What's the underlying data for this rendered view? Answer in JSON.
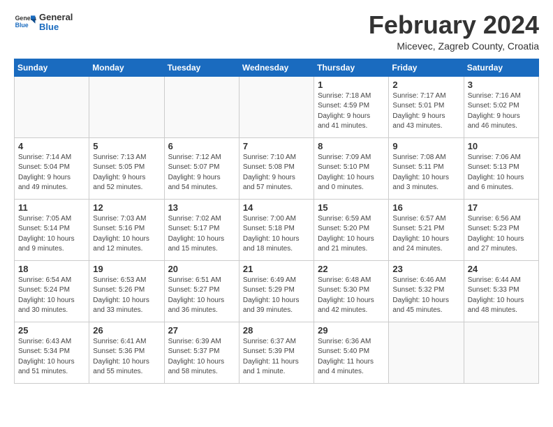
{
  "header": {
    "logo_line1": "General",
    "logo_line2": "Blue",
    "month_title": "February 2024",
    "location": "Micevec, Zagreb County, Croatia"
  },
  "weekdays": [
    "Sunday",
    "Monday",
    "Tuesday",
    "Wednesday",
    "Thursday",
    "Friday",
    "Saturday"
  ],
  "weeks": [
    [
      {
        "day": "",
        "info": ""
      },
      {
        "day": "",
        "info": ""
      },
      {
        "day": "",
        "info": ""
      },
      {
        "day": "",
        "info": ""
      },
      {
        "day": "1",
        "info": "Sunrise: 7:18 AM\nSunset: 4:59 PM\nDaylight: 9 hours\nand 41 minutes."
      },
      {
        "day": "2",
        "info": "Sunrise: 7:17 AM\nSunset: 5:01 PM\nDaylight: 9 hours\nand 43 minutes."
      },
      {
        "day": "3",
        "info": "Sunrise: 7:16 AM\nSunset: 5:02 PM\nDaylight: 9 hours\nand 46 minutes."
      }
    ],
    [
      {
        "day": "4",
        "info": "Sunrise: 7:14 AM\nSunset: 5:04 PM\nDaylight: 9 hours\nand 49 minutes."
      },
      {
        "day": "5",
        "info": "Sunrise: 7:13 AM\nSunset: 5:05 PM\nDaylight: 9 hours\nand 52 minutes."
      },
      {
        "day": "6",
        "info": "Sunrise: 7:12 AM\nSunset: 5:07 PM\nDaylight: 9 hours\nand 54 minutes."
      },
      {
        "day": "7",
        "info": "Sunrise: 7:10 AM\nSunset: 5:08 PM\nDaylight: 9 hours\nand 57 minutes."
      },
      {
        "day": "8",
        "info": "Sunrise: 7:09 AM\nSunset: 5:10 PM\nDaylight: 10 hours\nand 0 minutes."
      },
      {
        "day": "9",
        "info": "Sunrise: 7:08 AM\nSunset: 5:11 PM\nDaylight: 10 hours\nand 3 minutes."
      },
      {
        "day": "10",
        "info": "Sunrise: 7:06 AM\nSunset: 5:13 PM\nDaylight: 10 hours\nand 6 minutes."
      }
    ],
    [
      {
        "day": "11",
        "info": "Sunrise: 7:05 AM\nSunset: 5:14 PM\nDaylight: 10 hours\nand 9 minutes."
      },
      {
        "day": "12",
        "info": "Sunrise: 7:03 AM\nSunset: 5:16 PM\nDaylight: 10 hours\nand 12 minutes."
      },
      {
        "day": "13",
        "info": "Sunrise: 7:02 AM\nSunset: 5:17 PM\nDaylight: 10 hours\nand 15 minutes."
      },
      {
        "day": "14",
        "info": "Sunrise: 7:00 AM\nSunset: 5:18 PM\nDaylight: 10 hours\nand 18 minutes."
      },
      {
        "day": "15",
        "info": "Sunrise: 6:59 AM\nSunset: 5:20 PM\nDaylight: 10 hours\nand 21 minutes."
      },
      {
        "day": "16",
        "info": "Sunrise: 6:57 AM\nSunset: 5:21 PM\nDaylight: 10 hours\nand 24 minutes."
      },
      {
        "day": "17",
        "info": "Sunrise: 6:56 AM\nSunset: 5:23 PM\nDaylight: 10 hours\nand 27 minutes."
      }
    ],
    [
      {
        "day": "18",
        "info": "Sunrise: 6:54 AM\nSunset: 5:24 PM\nDaylight: 10 hours\nand 30 minutes."
      },
      {
        "day": "19",
        "info": "Sunrise: 6:53 AM\nSunset: 5:26 PM\nDaylight: 10 hours\nand 33 minutes."
      },
      {
        "day": "20",
        "info": "Sunrise: 6:51 AM\nSunset: 5:27 PM\nDaylight: 10 hours\nand 36 minutes."
      },
      {
        "day": "21",
        "info": "Sunrise: 6:49 AM\nSunset: 5:29 PM\nDaylight: 10 hours\nand 39 minutes."
      },
      {
        "day": "22",
        "info": "Sunrise: 6:48 AM\nSunset: 5:30 PM\nDaylight: 10 hours\nand 42 minutes."
      },
      {
        "day": "23",
        "info": "Sunrise: 6:46 AM\nSunset: 5:32 PM\nDaylight: 10 hours\nand 45 minutes."
      },
      {
        "day": "24",
        "info": "Sunrise: 6:44 AM\nSunset: 5:33 PM\nDaylight: 10 hours\nand 48 minutes."
      }
    ],
    [
      {
        "day": "25",
        "info": "Sunrise: 6:43 AM\nSunset: 5:34 PM\nDaylight: 10 hours\nand 51 minutes."
      },
      {
        "day": "26",
        "info": "Sunrise: 6:41 AM\nSunset: 5:36 PM\nDaylight: 10 hours\nand 55 minutes."
      },
      {
        "day": "27",
        "info": "Sunrise: 6:39 AM\nSunset: 5:37 PM\nDaylight: 10 hours\nand 58 minutes."
      },
      {
        "day": "28",
        "info": "Sunrise: 6:37 AM\nSunset: 5:39 PM\nDaylight: 11 hours\nand 1 minute."
      },
      {
        "day": "29",
        "info": "Sunrise: 6:36 AM\nSunset: 5:40 PM\nDaylight: 11 hours\nand 4 minutes."
      },
      {
        "day": "",
        "info": ""
      },
      {
        "day": "",
        "info": ""
      }
    ]
  ]
}
